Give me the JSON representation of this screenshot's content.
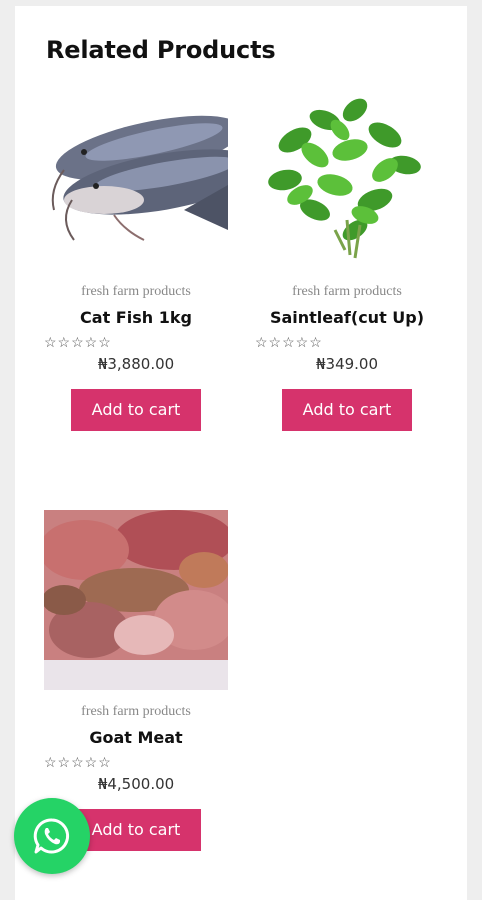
{
  "section": {
    "title": "Related Products"
  },
  "products": [
    {
      "image_icon": "catfish-image",
      "category": "fresh farm products",
      "name": "Cat Fish 1kg",
      "rating_stars": "☆☆☆☆☆",
      "price": "₦3,880.00",
      "button_label": "Add to cart"
    },
    {
      "image_icon": "scentleaf-image",
      "category": "fresh farm products",
      "name": "Saintleaf(cut Up)",
      "rating_stars": "☆☆☆☆☆",
      "price": "₦349.00",
      "button_label": "Add to cart"
    },
    {
      "image_icon": "goat-meat-image",
      "category": "fresh farm products",
      "name": "Goat Meat",
      "rating_stars": "☆☆☆☆☆",
      "price": "₦4,500.00",
      "button_label": "Add to cart"
    }
  ],
  "colors": {
    "button": "#d6336c",
    "whatsapp": "#25d366"
  },
  "floating": {
    "whatsapp_icon": "whatsapp-icon"
  }
}
